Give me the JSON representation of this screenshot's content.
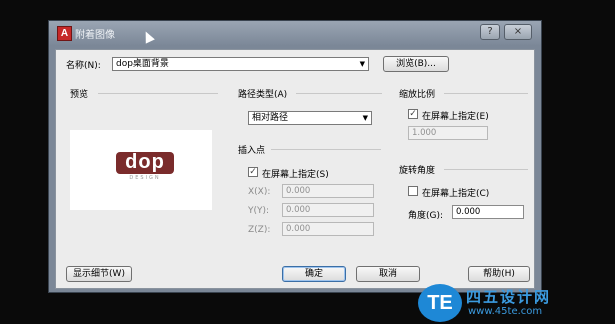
{
  "dialog": {
    "title": "附着图像",
    "app_logo": "A",
    "window_buttons": [
      "?",
      "×"
    ],
    "name_label": "名称(N):",
    "name_value": "dop桌面背景",
    "browse_label": "浏览(B)...",
    "preview_label": "预览",
    "path_type_label": "路径类型(A)",
    "path_type_value": "相对路径",
    "scale_label": "缩放比例",
    "scale_onscreen": "在屏幕上指定(E)",
    "scale_value": "1.000",
    "insert_label": "插入点",
    "insert_onscreen": "在屏幕上指定(S)",
    "x_label": "X(X):",
    "x_value": "0.000",
    "y_label": "Y(Y):",
    "y_value": "0.000",
    "z_label": "Z(Z):",
    "z_value": "0.000",
    "rotation_label": "旋转角度",
    "rotation_onscreen": "在屏幕上指定(C)",
    "angle_label": "角度(G):",
    "angle_value": "0.000",
    "details_button": "显示细节(W)",
    "ok_button": "确定",
    "cancel_button": "取消",
    "help_button": "帮助(H)",
    "preview_logo_text": "dop",
    "preview_logo_sub": "DESIGN",
    "check_mark": "✓"
  },
  "watermark": {
    "badge": "TE",
    "title": "四五设计网",
    "url": "www.45te.com"
  },
  "colors": {
    "title_bar": "#8a95a5",
    "logo_red": "#c62828",
    "dop_red": "#7a2b2b",
    "watermark_blue": "#1e88d6"
  }
}
